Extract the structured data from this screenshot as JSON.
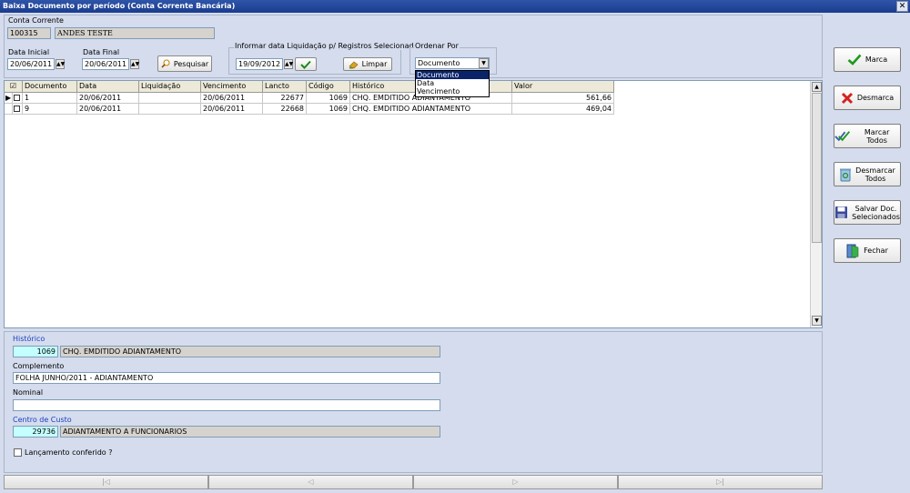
{
  "window": {
    "title": "Baixa Documento por período (Conta Corrente Bancária)",
    "close_glyph": "✕"
  },
  "conta": {
    "label": "Conta Corrente",
    "codigo": "100315",
    "nome": "ANDES TESTE"
  },
  "datas": {
    "inicial_label": "Data Inicial",
    "inicial_value": "20/06/2011",
    "final_label": "Data Final",
    "final_value": "20/06/2011"
  },
  "pesquisar_label": "Pesquisar",
  "liquidacao": {
    "label": "Informar data Liquidação p/ Registros Selecionados",
    "value": "19/09/2012",
    "limpar_label": "Limpar"
  },
  "ordenar": {
    "label": "Ordenar Por",
    "value": "Documento",
    "options": [
      "Documento",
      "Data",
      "Vencimento"
    ]
  },
  "grid": {
    "columns": [
      "Documento",
      "Data",
      "Liquidação",
      "Vencimento",
      "Lancto",
      "Código",
      "Histórico",
      "Valor"
    ],
    "rows": [
      {
        "documento": "1",
        "data": "20/06/2011",
        "liquidacao": "",
        "vencimento": "20/06/2011",
        "lancto": "22677",
        "codigo": "1069",
        "historico": "CHQ. EMDITIDO ADIANTAMENTO",
        "valor": "561,66"
      },
      {
        "documento": "9",
        "data": "20/06/2011",
        "liquidacao": "",
        "vencimento": "20/06/2011",
        "lancto": "22668",
        "codigo": "1069",
        "historico": "CHQ. EMDITIDO ADIANTAMENTO",
        "valor": "469,04"
      }
    ]
  },
  "detalhe": {
    "historico_label": "Histórico",
    "historico_codigo": "1069",
    "historico_desc": "CHQ. EMDITIDO ADIANTAMENTO",
    "complemento_label": "Complemento",
    "complemento_value": "FOLHA JUNHO/2011 - ADIANTAMENTO",
    "nominal_label": "Nominal",
    "nominal_value": "",
    "centro_label": "Centro de Custo",
    "centro_codigo": "29736",
    "centro_desc": "ADIANTAMENTO A FUNCIONARIOS",
    "conferido_label": "Lançamento conferido ?"
  },
  "nav": {
    "first": "|◁",
    "prev": "◁",
    "next": "▷",
    "last": "▷|"
  },
  "actions": {
    "marca": "Marca",
    "desmarca": "Desmarca",
    "marcar_todos": "Marcar Todos",
    "desmarcar_todos": "Desmarcar\nTodos",
    "salvar": "Salvar Doc.\nSelecionados",
    "fechar": "Fechar"
  },
  "colors": {
    "title_bar": "#1a3c8e",
    "background": "#d4dced",
    "readonly_field": "#d6d3ce",
    "code_field": "#c4ffff",
    "label_blue": "#1c3fbf",
    "selected_item": "#0a246a"
  }
}
